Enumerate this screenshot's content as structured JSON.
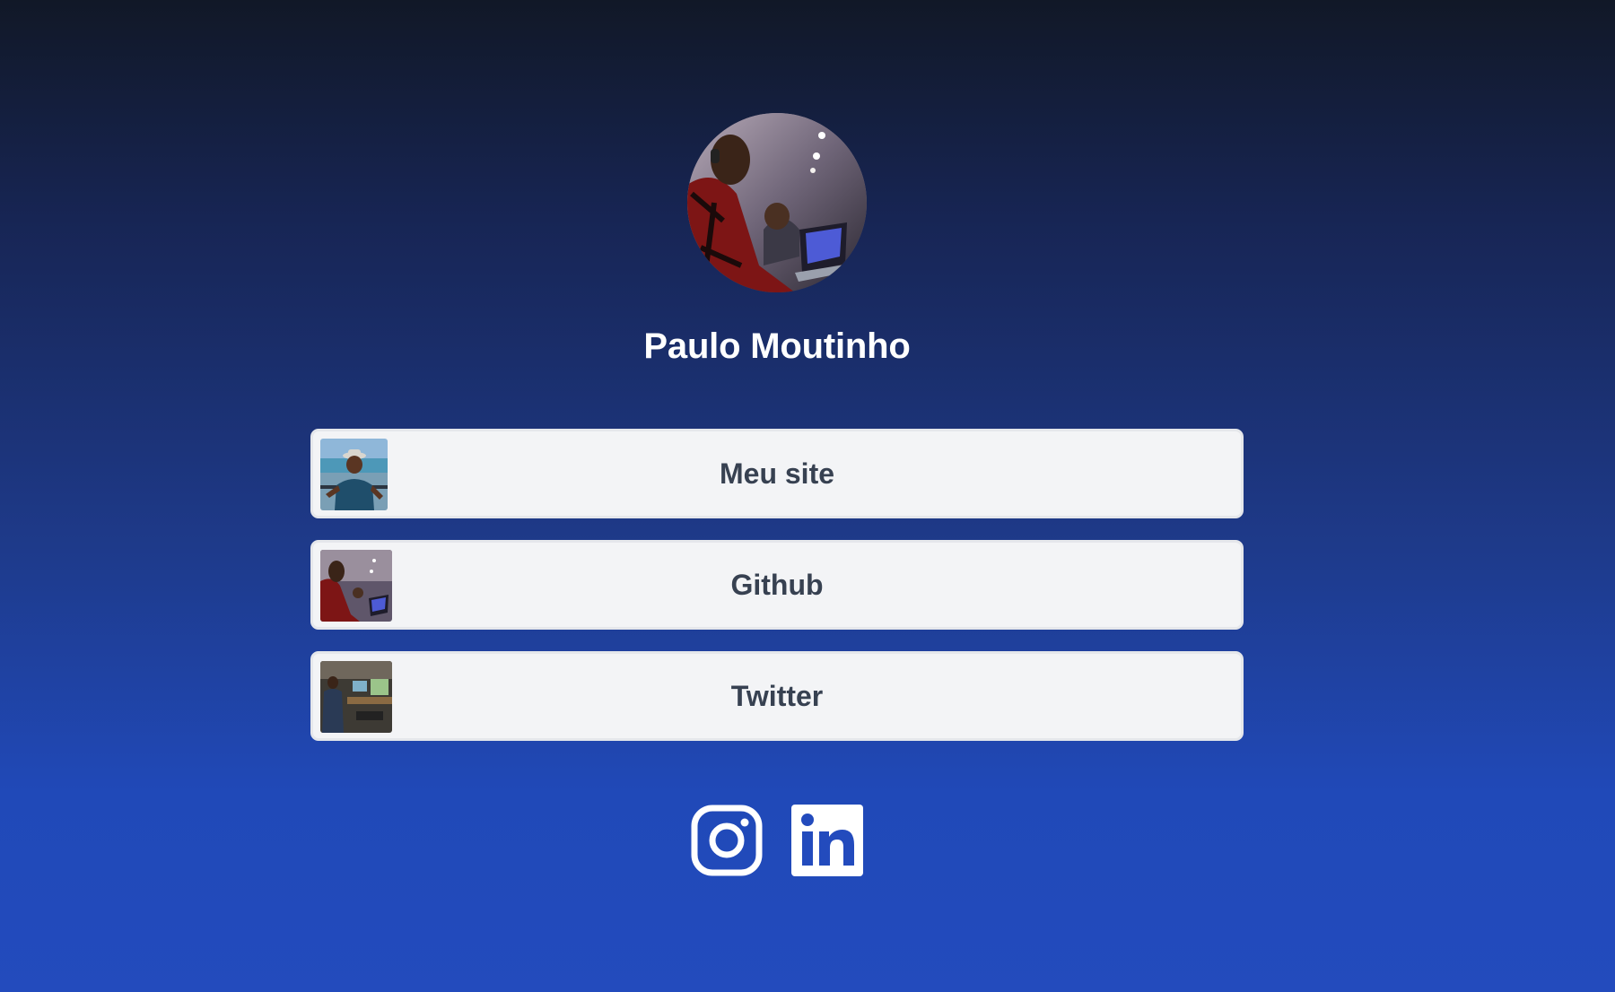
{
  "profile": {
    "name": "Paulo Moutinho",
    "avatar_icon": "profile-photo"
  },
  "links": [
    {
      "label": "Meu site",
      "thumb_icon": "photo-man-hat-beach"
    },
    {
      "label": "Github",
      "thumb_icon": "photo-man-laptop"
    },
    {
      "label": "Twitter",
      "thumb_icon": "photo-people-office-screens"
    }
  ],
  "social": [
    {
      "name": "Instagram",
      "icon": "instagram-icon"
    },
    {
      "name": "LinkedIn",
      "icon": "linkedin-icon"
    }
  ],
  "colors": {
    "background_top": "#111827",
    "background_bottom": "#234bbd",
    "card_bg": "#f3f4f6",
    "card_text": "#374151",
    "name_text": "#ffffff"
  }
}
